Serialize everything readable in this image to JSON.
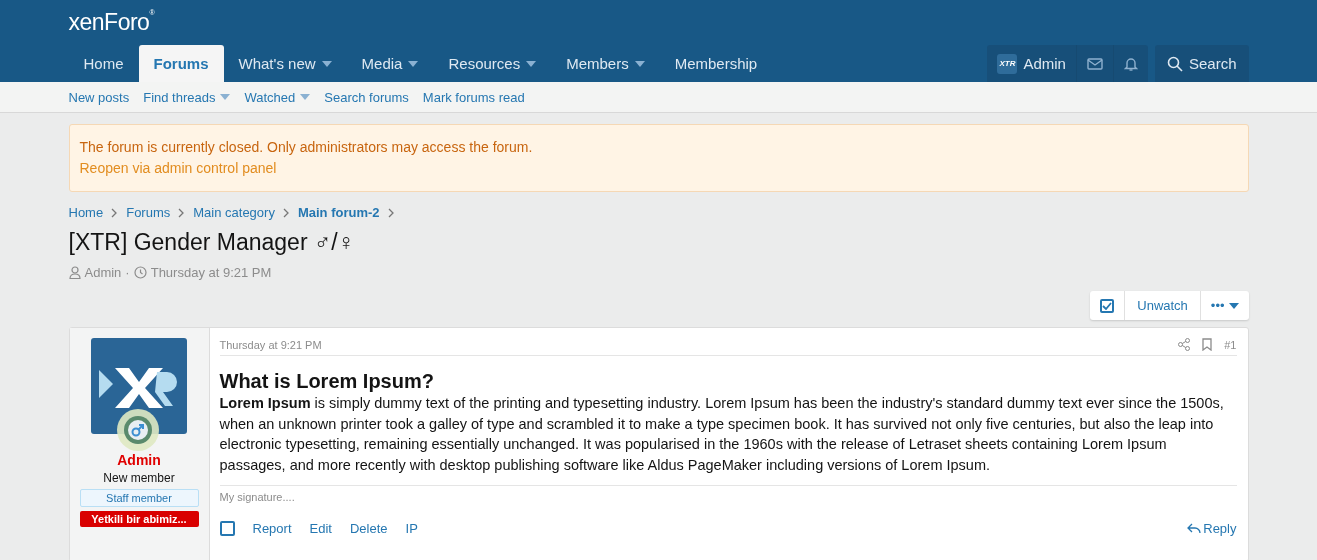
{
  "logo": {
    "text": "xenForo",
    "mark": "®"
  },
  "nav": [
    {
      "label": "Home",
      "selected": false,
      "has_menu": false
    },
    {
      "label": "Forums",
      "selected": true,
      "has_menu": false
    },
    {
      "label": "What's new",
      "selected": false,
      "has_menu": true
    },
    {
      "label": "Media",
      "selected": false,
      "has_menu": true
    },
    {
      "label": "Resources",
      "selected": false,
      "has_menu": true
    },
    {
      "label": "Members",
      "selected": false,
      "has_menu": true
    },
    {
      "label": "Membership",
      "selected": false,
      "has_menu": false
    }
  ],
  "account": {
    "avatar_text": "XTR",
    "name": "Admin"
  },
  "search": {
    "label": "Search"
  },
  "subnav": [
    {
      "label": "New posts",
      "has_menu": false
    },
    {
      "label": "Find threads",
      "has_menu": true
    },
    {
      "label": "Watched",
      "has_menu": true
    },
    {
      "label": "Search forums",
      "has_menu": false
    },
    {
      "label": "Mark forums read",
      "has_menu": false
    }
  ],
  "notice": {
    "text": "The forum is currently closed. Only administrators may access the forum.",
    "link": "Reopen via admin control panel"
  },
  "breadcrumbs": [
    {
      "label": "Home",
      "current": false
    },
    {
      "label": "Forums",
      "current": false
    },
    {
      "label": "Main category",
      "current": false
    },
    {
      "label": "Main forum-2",
      "current": true
    }
  ],
  "thread": {
    "title": "[XTR] Gender Manager ♂/♀",
    "author": "Admin",
    "separator": "·",
    "date": "Thursday at 9:21 PM"
  },
  "thread_actions": {
    "watch_checked": true,
    "unwatch": "Unwatch",
    "more": "•••"
  },
  "post": {
    "user": {
      "name": "Admin",
      "title": "New member",
      "banners": [
        {
          "text": "Staff member",
          "kind": "staff"
        },
        {
          "text": "Yetkili bir abimiz...",
          "kind": "red"
        }
      ]
    },
    "date": "Thursday at 9:21 PM",
    "number": "#1",
    "heading": "What is Lorem Ipsum?",
    "body": "**Lorem Ipsum** is simply dummy text of the printing and typesetting industry. Lorem Ipsum has been the industry's standard dummy text ever since the 1500s, when an unknown printer took a galley of type and scrambled it to make a type specimen book. It has survived not only five centuries, but also the leap into electronic typesetting, remaining essentially unchanged. It was popularised in the 1960s with the release of Letraset sheets containing Lorem Ipsum passages, and more recently with desktop publishing software like Aldus PageMaker including versions of Lorem Ipsum.",
    "signature": "My signature....",
    "select_checked": false,
    "actions": [
      "Report",
      "Edit",
      "Delete",
      "IP"
    ],
    "reply": "Reply"
  }
}
